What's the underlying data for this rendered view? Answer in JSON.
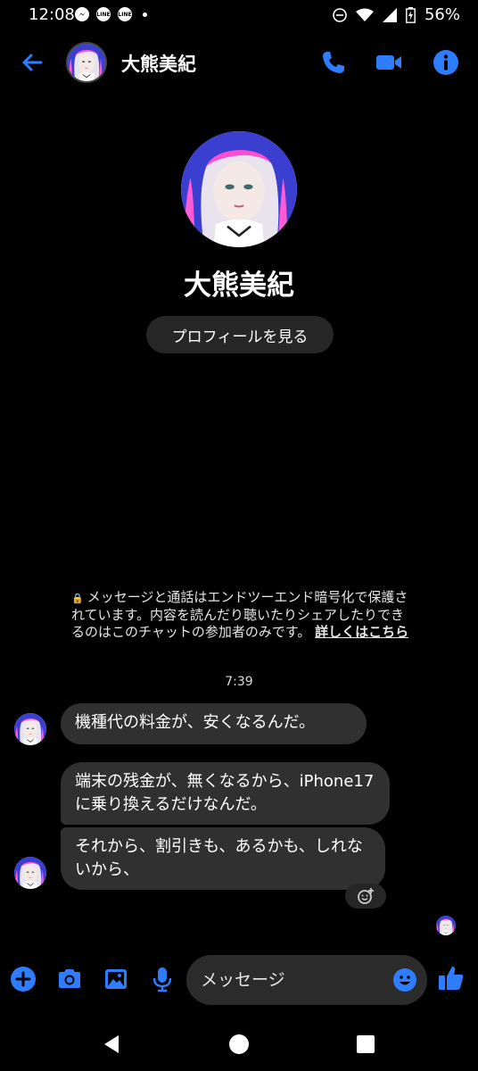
{
  "status_bar": {
    "time": "12:08",
    "app_badges": [
      "LINE",
      "LINE"
    ],
    "battery": "56%"
  },
  "header": {
    "name": "大熊美紀"
  },
  "profile": {
    "name": "大熊美紀",
    "view_profile_label": "プロフィールを見る"
  },
  "encryption_notice": {
    "text": "メッセージと通話はエンドツーエンド暗号化で保護されています。内容を読んだり聴いたりシェアしたりできるのはこのチャットの参加者のみです。",
    "link": "詳しくはこちら"
  },
  "timestamp": "7:39",
  "messages": [
    {
      "text": "機種代の料金が、安くなるんだ。"
    },
    {
      "text": "端末の残金が、無くなるから、iPhone17に乗り換えるだけなんだ。"
    },
    {
      "text": "それから、割引きも、あるかも、しれないから、"
    }
  ],
  "composer": {
    "placeholder": "メッセージ"
  },
  "colors": {
    "accent": "#2f7dff",
    "bubble": "#303030",
    "background": "#000000"
  },
  "icons": {
    "header": [
      "back-arrow-icon",
      "phone-icon",
      "video-icon",
      "info-icon"
    ],
    "composer": [
      "plus-icon",
      "camera-icon",
      "image-icon",
      "mic-icon",
      "emoji-icon",
      "thumbs-up-icon"
    ],
    "nav": [
      "nav-back-icon",
      "nav-home-icon",
      "nav-recents-icon"
    ]
  }
}
